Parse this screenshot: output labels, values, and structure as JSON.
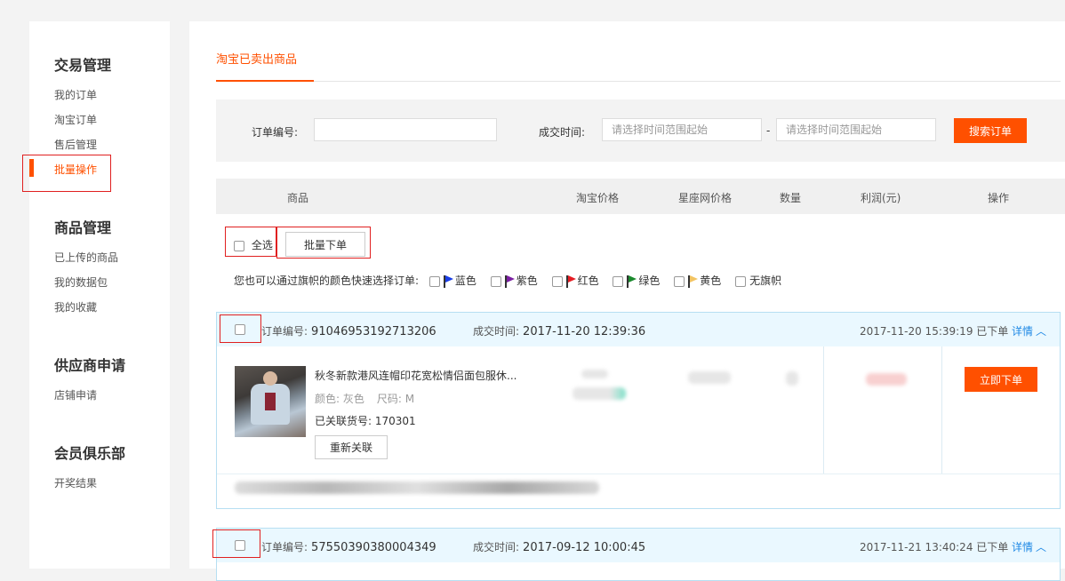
{
  "sidebar": {
    "groups": [
      {
        "title": "交易管理",
        "items": [
          "我的订单",
          "淘宝订单",
          "售后管理",
          "批量操作"
        ]
      },
      {
        "title": "商品管理",
        "items": [
          "已上传的商品",
          "我的数据包",
          "我的收藏"
        ]
      },
      {
        "title": "供应商申请",
        "items": [
          "店铺申请"
        ]
      },
      {
        "title": "会员俱乐部",
        "items": [
          "开奖结果"
        ]
      }
    ],
    "active_item": "批量操作"
  },
  "tab": {
    "label": "淘宝已卖出商品"
  },
  "search": {
    "order_no_label": "订单编号:",
    "order_no_value": "",
    "time_label": "成交时间:",
    "start_placeholder": "请选择时间范围起始",
    "dash": "-",
    "end_placeholder": "请选择时间范围起始",
    "search_button": "搜索订单"
  },
  "table_headers": [
    "商品",
    "淘宝价格",
    "星座网价格",
    "数量",
    "利润(元)",
    "操作"
  ],
  "batch": {
    "select_all_label": "全选",
    "batch_order_button": "批量下单"
  },
  "flag_filter": {
    "lead": "您也可以通过旗帜的颜色快速选择订单:",
    "options": [
      {
        "label": "蓝色",
        "color": "#1a3ee6"
      },
      {
        "label": "紫色",
        "color": "#7b1fa2"
      },
      {
        "label": "红色",
        "color": "#e51c23"
      },
      {
        "label": "绿色",
        "color": "#1b8a2e"
      },
      {
        "label": "黄色",
        "color": "#f2c463"
      },
      {
        "label": "无旗帜",
        "color": ""
      }
    ]
  },
  "orders": [
    {
      "order_no_label": "订单编号:",
      "order_no": "91046953192713206",
      "deal_time_label": "成交时间:",
      "deal_time": "2017-11-20 12:39:36",
      "status_time": "2017-11-20 15:39:19 已下单",
      "detail_label": "详情",
      "product_title": "秋冬新款港风连帽印花宽松情侣面包服休...",
      "color_label": "颜色: 灰色",
      "size_label": "尺码: M",
      "linked_sku": "已关联货号: 170301",
      "relink_button": "重新关联",
      "order_now_button": "立即下单"
    },
    {
      "order_no_label": "订单编号:",
      "order_no": "57550390380004349",
      "deal_time_label": "成交时间:",
      "deal_time": "2017-09-12 10:00:45",
      "status_time": "2017-11-21 13:40:24 已下单",
      "detail_label": "详情"
    }
  ]
}
